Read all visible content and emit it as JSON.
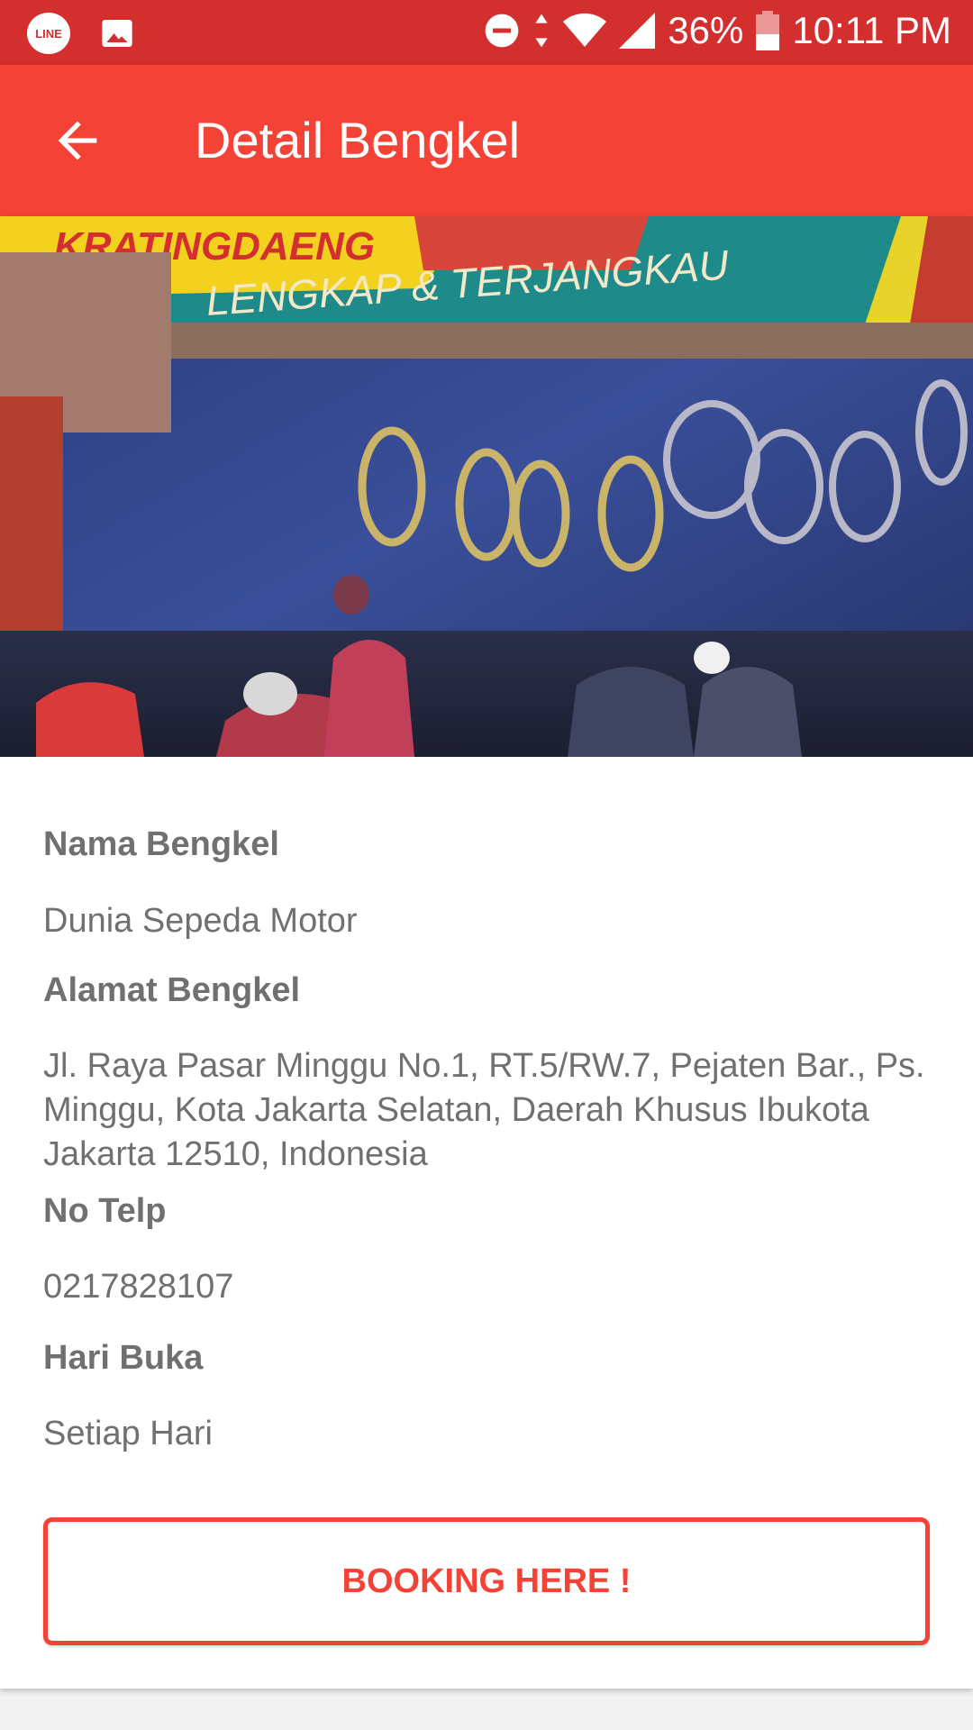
{
  "status_bar": {
    "line_badge": "LINE",
    "battery": "36%",
    "time": "10:11 PM"
  },
  "app_bar": {
    "title": "Detail Bengkel"
  },
  "photo": {
    "signage_top": "KRATINGDAENG",
    "signage_bottom": "LENGKAP & TERJANGKAU"
  },
  "details": {
    "name_label": "Nama Bengkel",
    "name_value": "Dunia Sepeda Motor",
    "address_label": "Alamat Bengkel",
    "address_value": "Jl. Raya Pasar Minggu No.1, RT.5/RW.7, Pejaten Bar., Ps. Minggu, Kota Jakarta Selatan, Daerah Khusus Ibukota Jakarta 12510, Indonesia",
    "phone_label": "No Telp",
    "phone_value": "0217828107",
    "days_label": "Hari Buka",
    "days_value": "Setiap Hari"
  },
  "booking_button": {
    "label": "BOOKING HERE !"
  },
  "colors": {
    "status_bar": "#d32f2f",
    "app_bar": "#f44336",
    "accent": "#f44336",
    "text": "#707070"
  },
  "icons": [
    "line-app-icon",
    "gallery-icon",
    "dnd-icon",
    "data-arrows-icon",
    "wifi-icon",
    "signal-icon",
    "battery-icon",
    "back-arrow-icon"
  ]
}
